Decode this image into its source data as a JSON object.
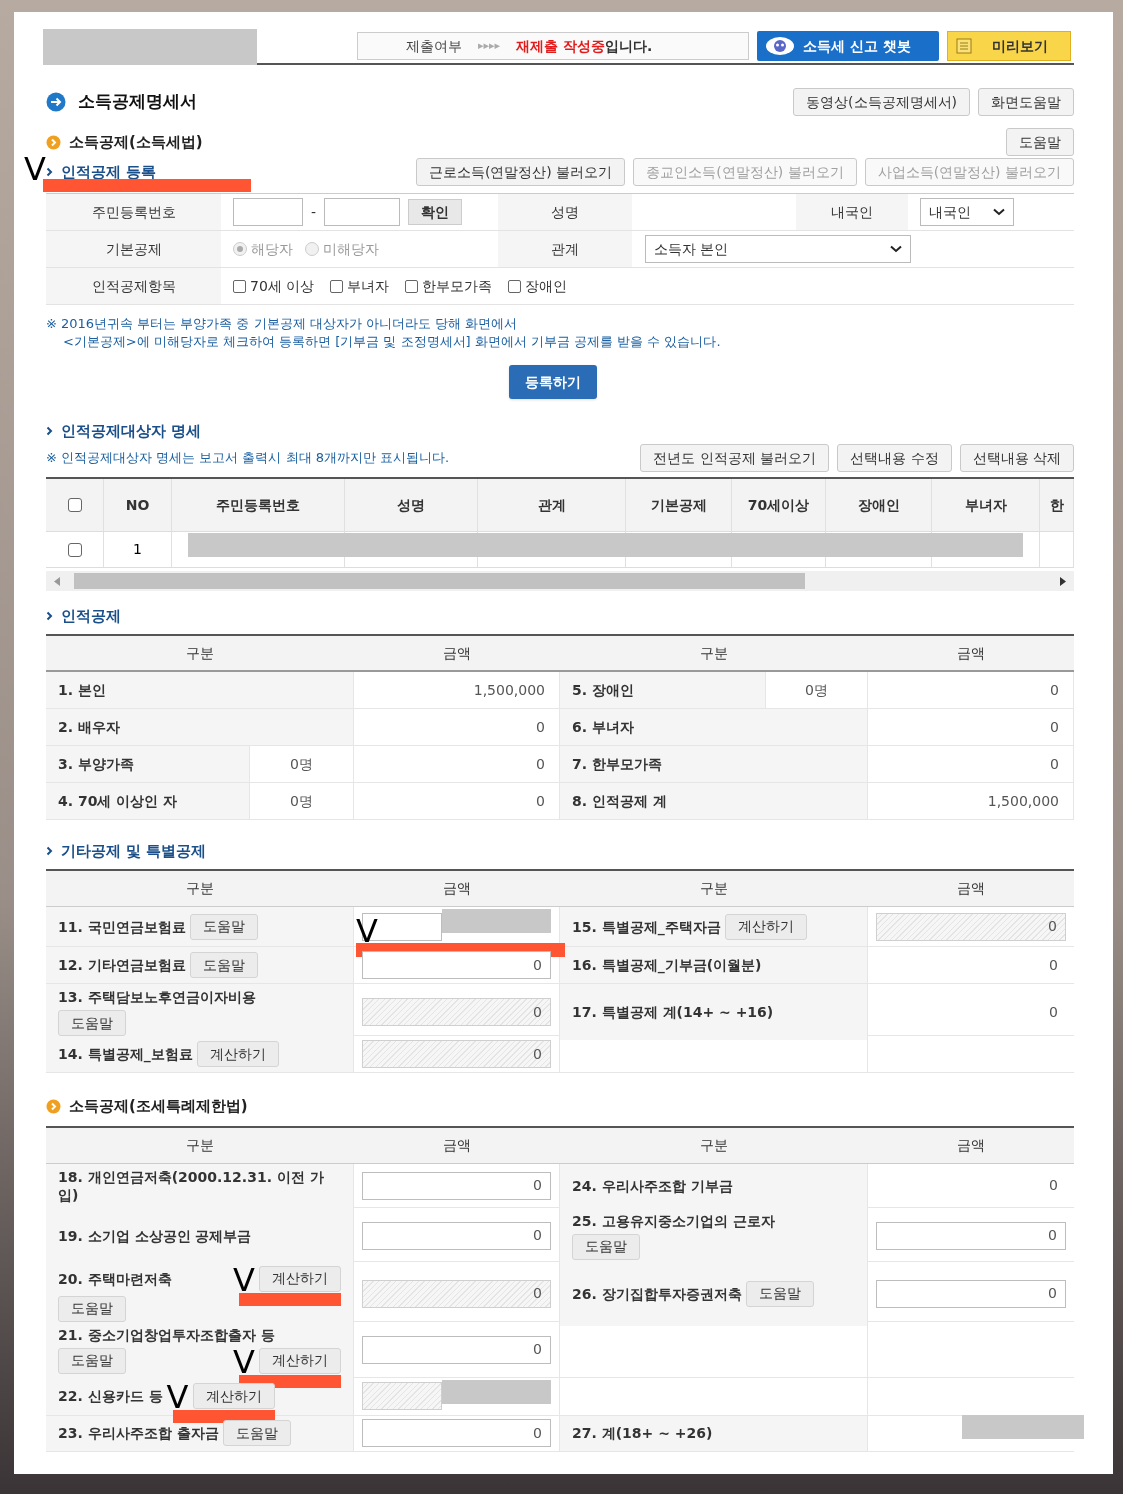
{
  "top_bar": {
    "redacted": true,
    "status_label": "제출여부",
    "status_arrows": "▸▸▸▸",
    "status_highlight": "재제출 작성중",
    "status_suffix": "입니다.",
    "chatbot_button": "소득세 신고 챗봇",
    "preview_button": "미리보기"
  },
  "page_title": "소득공제명세서",
  "title_buttons": [
    "동영상(소득공제명세서)",
    "화면도움말"
  ],
  "income_tax_section": {
    "title": "소득공제(소득세법)",
    "help_button": "도움말"
  },
  "registration": {
    "title": "인적공제 등록",
    "annotation": "V",
    "load_buttons": [
      {
        "label": "근로소득(연말정산) 불러오기",
        "disabled": false
      },
      {
        "label": "종교인소득(연말정산) 불러오기",
        "disabled": true
      },
      {
        "label": "사업소득(연말정산) 불러오기",
        "disabled": true
      }
    ],
    "id_label": "주민등록번호",
    "id_separator": "-",
    "confirm_button": "확인",
    "name_label": "성명",
    "nationality_label": "내국인",
    "nationality_value": "내국인",
    "basic_label": "기본공제",
    "basic_options": [
      {
        "label": "해당자",
        "selected": true,
        "disabled": true
      },
      {
        "label": "미해당자",
        "selected": false,
        "disabled": true
      }
    ],
    "relation_label": "관계",
    "relation_value": "소득자 본인",
    "items_label": "인적공제항목",
    "items": [
      {
        "label": "70세 이상",
        "checked": false
      },
      {
        "label": "부녀자",
        "checked": false
      },
      {
        "label": "한부모가족",
        "checked": false
      },
      {
        "label": "장애인",
        "checked": false
      }
    ],
    "note_mark": "※",
    "note_lines": [
      "2016년귀속 부터는 부양가족 중 기본공제 대상자가 아니더라도 당해 화면에서",
      "<기본공제>에 미해당자로 체크하여 등록하면 [기부금 및 조정명세서] 화면에서 기부금 공제를 받을 수 있습니다."
    ],
    "register_button": "등록하기"
  },
  "dependents": {
    "title": "인적공제대상자 명세",
    "note": "※ 인적공제대상자 명세는 보고서 출력시 최대 8개까지만 표시됩니다.",
    "buttons": [
      "전년도 인적공제 불러오기",
      "선택내용 수정",
      "선택내용 삭제"
    ],
    "columns": [
      "NO",
      "주민등록번호",
      "성명",
      "관계",
      "기본공제",
      "70세이상",
      "장애인",
      "부녀자",
      "한"
    ],
    "all_checked": false,
    "rows": [
      {
        "no": "1",
        "checked": false,
        "redacted": true
      }
    ]
  },
  "personal_deduction": {
    "title": "인적공제",
    "headers": [
      "구분",
      "금액",
      "구분",
      "금액"
    ],
    "rows": [
      {
        "left": {
          "label": "1. 본인",
          "amount": "1,500,000"
        },
        "right": {
          "label": "5. 장애인",
          "count": "0명",
          "amount": "0"
        }
      },
      {
        "left": {
          "label": "2. 배우자",
          "amount": "0"
        },
        "right": {
          "label": "6. 부녀자",
          "amount": "0"
        }
      },
      {
        "left": {
          "label": "3. 부양가족",
          "count": "0명",
          "amount": "0"
        },
        "right": {
          "label": "7. 한부모가족",
          "amount": "0"
        }
      },
      {
        "left": {
          "label": "4. 70세 이상인 자",
          "count": "0명",
          "amount": "0"
        },
        "right": {
          "label": "8. 인적공제 계",
          "amount": "1,500,000"
        }
      }
    ]
  },
  "other_deduction": {
    "title": "기타공제 및 특별공제",
    "headers": [
      "구분",
      "금액",
      "구분",
      "금액"
    ],
    "rows": [
      {
        "left": {
          "label": "11. 국민연금보험료",
          "inline_buttons": [
            {
              "label": "도움말"
            }
          ],
          "kind": "input",
          "redacted": true,
          "annotation": "V"
        },
        "right": {
          "label": "15. 특별공제_주택자금",
          "inline_buttons": [
            {
              "label": "계산하기"
            }
          ],
          "kind": "locked",
          "amount": "0"
        }
      },
      {
        "left": {
          "label": "12. 기타연금보험료",
          "inline_buttons": [
            {
              "label": "도움말"
            }
          ],
          "kind": "input",
          "amount": "0"
        },
        "right": {
          "label": "16. 특별공제_기부금(이월분)",
          "kind": "text",
          "amount": "0"
        }
      },
      {
        "left": {
          "label": "13. 주택담보노후연금이자비용",
          "below_buttons": [
            {
              "label": "도움말"
            }
          ],
          "kind": "locked",
          "amount": "0"
        },
        "right": {
          "label": "17. 특별공제 계(14+ ~ +16)",
          "kind": "text",
          "amount": "0"
        }
      },
      {
        "left": {
          "label": "14. 특별공제_보험료",
          "inline_buttons": [
            {
              "label": "계산하기"
            }
          ],
          "kind": "locked",
          "amount": "0"
        }
      }
    ]
  },
  "special_tax_section": {
    "title": "소득공제(조세특례제한법)",
    "headers": [
      "구분",
      "금액",
      "구분",
      "금액"
    ],
    "rows": [
      {
        "left": {
          "label": "18. 개인연금저축(2000.12.31. 이전 가입)",
          "kind": "input",
          "amount": "0"
        },
        "right": {
          "label": "24. 우리사주조합 기부금",
          "kind": "text",
          "amount": "0"
        }
      },
      {
        "left": {
          "label": "19. 소기업 소상공인 공제부금",
          "kind": "input",
          "amount": "0"
        },
        "right": {
          "label": "25. 고용유지중소기업의 근로자",
          "below_buttons": [
            {
              "label": "도움말"
            }
          ],
          "kind": "input",
          "amount": "0"
        }
      },
      {
        "left": {
          "label": "20. 주택마련저축",
          "inline_buttons": [
            {
              "label": "계산하기",
              "annotation": "V"
            }
          ],
          "below_buttons": [
            {
              "label": "도움말"
            }
          ],
          "kind": "locked",
          "amount": "0"
        },
        "right": {
          "label": "26. 장기집합투자증권저축",
          "inline_buttons": [
            {
              "label": "도움말"
            }
          ],
          "kind": "input",
          "amount": "0"
        }
      },
      {
        "left": {
          "label": "21. 중소기업창업투자조합출자 등",
          "below_buttons": [
            {
              "label": "도움말"
            },
            {
              "label": "계산하기",
              "annotation": "V"
            }
          ],
          "kind": "input",
          "amount": "0"
        }
      },
      {
        "left": {
          "label": "22. 신용카드 등",
          "inline_buttons": [
            {
              "label": "계산하기",
              "annotation": "V"
            }
          ],
          "kind": "locked",
          "redacted": true
        }
      },
      {
        "left": {
          "label": "23. 우리사주조합 출자금",
          "inline_buttons": [
            {
              "label": "도움말"
            }
          ],
          "kind": "input",
          "amount": "0"
        },
        "right": {
          "label": "27. 계(18+ ~ +26)",
          "kind": "text",
          "redacted": true
        }
      }
    ]
  }
}
